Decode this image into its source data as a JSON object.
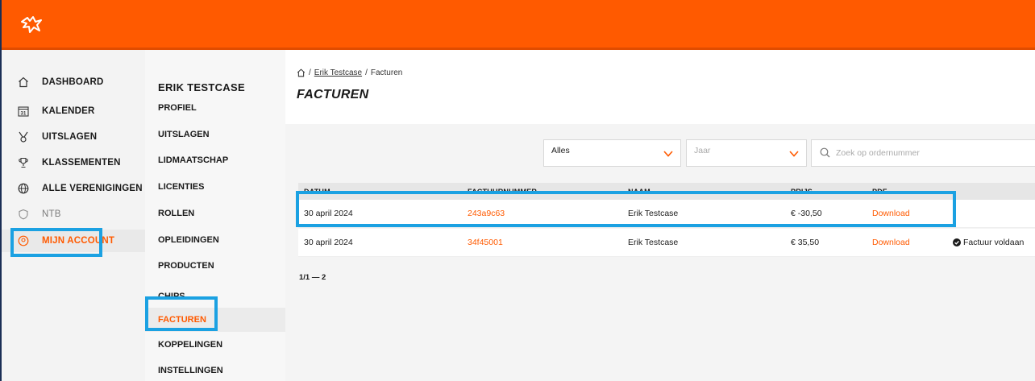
{
  "sidebar": {
    "items": [
      {
        "label": "DASHBOARD",
        "icon": "home-icon"
      },
      {
        "label": "KALENDER",
        "icon": "calendar-icon",
        "icon_text": "31"
      },
      {
        "label": "UITSLAGEN",
        "icon": "medal-icon"
      },
      {
        "label": "KLASSEMENTEN",
        "icon": "trophy-icon"
      },
      {
        "label": "ALLE VERENIGINGEN",
        "icon": "globe-icon"
      },
      {
        "label": "NTB",
        "icon": "shield-icon"
      },
      {
        "label": "MIJN ACCOUNT",
        "icon": "account-icon"
      }
    ]
  },
  "subnav": {
    "title": "ERIK TESTCASE",
    "items": [
      {
        "label": "PROFIEL"
      },
      {
        "label": "UITSLAGEN"
      },
      {
        "label": "LIDMAATSCHAP"
      },
      {
        "label": "LICENTIES"
      },
      {
        "label": "ROLLEN"
      },
      {
        "label": "OPLEIDINGEN"
      },
      {
        "label": "PRODUCTEN"
      },
      {
        "label": "CHIPS"
      },
      {
        "label": "FACTUREN"
      },
      {
        "label": "KOPPELINGEN"
      },
      {
        "label": "INSTELLINGEN"
      }
    ]
  },
  "breadcrumb": {
    "sep1": "/",
    "link": "Erik Testcase",
    "sep2": "/",
    "current": "Facturen"
  },
  "page": {
    "title": "FACTUREN"
  },
  "filters": {
    "type_value": "Alles",
    "year_placeholder": "Jaar",
    "search_placeholder": "Zoek op ordernummer"
  },
  "table": {
    "headers": {
      "datum": "DATUM",
      "factuurnummer": "FACTUURNUMMER",
      "naam": "NAAM",
      "prijs": "PRIJS",
      "pdf": "PDF"
    },
    "rows": [
      {
        "datum": "30 april 2024",
        "factuurnummer": "243a9c63",
        "naam": "Erik Testcase",
        "prijs": "€ -30,50",
        "pdf": "Download",
        "status": ""
      },
      {
        "datum": "30 april 2024",
        "factuurnummer": "34f45001",
        "naam": "Erik Testcase",
        "prijs": "€ 35,50",
        "pdf": "Download",
        "status": "Factuur voldaan"
      }
    ]
  },
  "pagination": {
    "text": "1/1 — 2"
  },
  "colors": {
    "brand": "#ff5a00",
    "highlight": "#1ba1e2"
  }
}
